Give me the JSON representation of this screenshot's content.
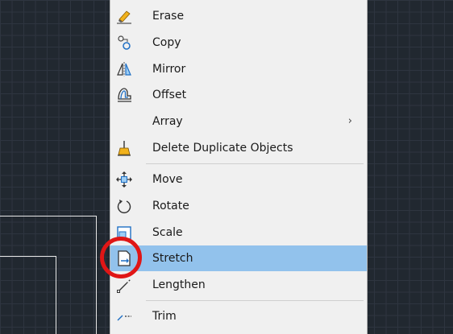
{
  "menu": {
    "items": [
      {
        "label": "Erase",
        "icon": "eraser-icon"
      },
      {
        "label": "Copy",
        "icon": "copy-icon"
      },
      {
        "label": "Mirror",
        "icon": "mirror-icon"
      },
      {
        "label": "Offset",
        "icon": "offset-icon"
      },
      {
        "label": "Array",
        "icon": "",
        "submenu_arrow": "›"
      },
      {
        "label": "Delete Duplicate Objects",
        "icon": "delete-duplicates-icon"
      },
      {
        "label": "Move",
        "icon": "move-icon"
      },
      {
        "label": "Rotate",
        "icon": "rotate-icon"
      },
      {
        "label": "Scale",
        "icon": "scale-icon"
      },
      {
        "label": "Stretch",
        "icon": "stretch-icon",
        "highlighted": true
      },
      {
        "label": "Lengthen",
        "icon": "lengthen-icon"
      },
      {
        "label": "Trim",
        "icon": "trim-icon"
      }
    ]
  },
  "colors": {
    "canvas_background": "#212830",
    "menu_background": "#f0f0f0",
    "hover_highlight": "#92c2ec",
    "annotation_circle": "#e01616"
  }
}
